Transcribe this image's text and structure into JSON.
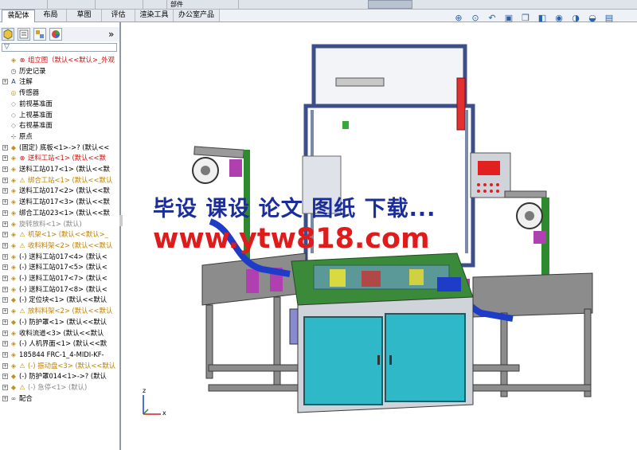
{
  "top_strip": {
    "label": "部件"
  },
  "tabs": [
    "装配体",
    "布局",
    "草图",
    "评估",
    "渲染工具",
    "办公室产品"
  ],
  "panel": {
    "collapse_glyph": "»",
    "filter_glyph": "▽"
  },
  "tree": [
    {
      "label": "组立图（默认<<默认>_外观",
      "style": "red",
      "icon": "assembly-icon",
      "mark": "error"
    },
    {
      "label": "历史记录",
      "icon": "history-icon"
    },
    {
      "label": "注解",
      "icon": "annotation-icon",
      "expander": "+"
    },
    {
      "label": "传感器",
      "icon": "sensor-icon"
    },
    {
      "label": "前视基准面",
      "icon": "plane-icon"
    },
    {
      "label": "上视基准面",
      "icon": "plane-icon"
    },
    {
      "label": "右视基准面",
      "icon": "plane-icon"
    },
    {
      "label": "原点",
      "icon": "origin-icon"
    },
    {
      "label": "(固定) 底板<1>->? (默认<<",
      "icon": "part-icon",
      "expander": "+"
    },
    {
      "label": "送料工站<1> (默认<<默",
      "style": "red",
      "icon": "subassembly-icon",
      "expander": "+",
      "mark": "error"
    },
    {
      "label": "送料工站017<1> (默认<<默",
      "icon": "subassembly-icon",
      "expander": "+"
    },
    {
      "label": "绑合工站<1> (默认<<默认",
      "style": "ylw",
      "icon": "subassembly-icon",
      "expander": "+",
      "mark": "warning"
    },
    {
      "label": "送料工站017<2> (默认<<默",
      "icon": "subassembly-icon",
      "expander": "+"
    },
    {
      "label": "送料工站017<3> (默认<<默",
      "icon": "subassembly-icon",
      "expander": "+"
    },
    {
      "label": "绑合工站023<1> (默认<<默",
      "icon": "subassembly-icon",
      "expander": "+"
    },
    {
      "label": "旋转放料<1> (默认)",
      "style": "gry",
      "icon": "subassembly-icon",
      "expander": "+"
    },
    {
      "label": "机架<1> (默认<<默认>_",
      "style": "ylw",
      "icon": "subassembly-icon",
      "expander": "+",
      "mark": "warning"
    },
    {
      "label": "收料料架<2> (默认<<默认",
      "style": "ylw",
      "icon": "subassembly-icon",
      "expander": "+",
      "mark": "warning"
    },
    {
      "label": "(-) 送料工站017<4> (默认<",
      "icon": "subassembly-icon",
      "expander": "+"
    },
    {
      "label": "(-) 送料工站017<5> (默认<",
      "icon": "subassembly-icon",
      "expander": "+"
    },
    {
      "label": "(-) 送料工站017<7> (默认<",
      "icon": "subassembly-icon",
      "expander": "+"
    },
    {
      "label": "(-) 送料工站017<8> (默认<",
      "icon": "subassembly-icon",
      "expander": "+"
    },
    {
      "label": "(-) 定位块<1> (默认<<默认",
      "icon": "part-icon",
      "expander": "+"
    },
    {
      "label": "放料料架<2> (默认<<默认",
      "style": "ylw",
      "icon": "subassembly-icon",
      "expander": "+",
      "mark": "warning"
    },
    {
      "label": "(-) 防护罩<1> (默认<<默认",
      "icon": "part-icon",
      "expander": "+"
    },
    {
      "label": "收料流道<3> (默认<<默认",
      "icon": "subassembly-icon",
      "expander": "+"
    },
    {
      "label": "(-) 人机界面<1> (默认<<默",
      "icon": "subassembly-icon",
      "expander": "+"
    },
    {
      "label": "185844 FRC-1_4-MIDI-KF-",
      "icon": "subassembly-icon",
      "expander": "+"
    },
    {
      "label": "(-) 振动盘<3> (默认<<默认",
      "style": "ylw",
      "icon": "subassembly-icon",
      "expander": "+",
      "mark": "warning"
    },
    {
      "label": "(-) 防护罩014<1>->? (默认",
      "icon": "part-icon",
      "expander": "+"
    },
    {
      "label": "(-) 急停<1> (默认)",
      "style": "gry",
      "icon": "part-icon",
      "expander": "+",
      "mark": "warning"
    },
    {
      "label": "配合",
      "icon": "mates-icon",
      "expander": "+"
    }
  ],
  "viewport": {
    "toolbar_icons": [
      "zoom-to-fit-icon",
      "zoom-area-icon",
      "previous-view-icon",
      "section-view-icon",
      "view-orientation-icon",
      "display-style-icon",
      "hide-show-icon",
      "edit-appearance-icon",
      "apply-scene-icon",
      "view-settings-icon"
    ],
    "watermark_line1": "毕设 课设 论文 图纸 下载...",
    "watermark_line2": "www.ytw818.com",
    "triad_labels": {
      "z": "z",
      "x": "x"
    }
  },
  "colors": {
    "frame_blue": "#3c4f8a",
    "cabinet_cyan": "#2fb8c8",
    "plate_green": "#3a8a3a",
    "rail_gray": "#8c8c8c",
    "belt_blue": "#1e3cc8"
  }
}
